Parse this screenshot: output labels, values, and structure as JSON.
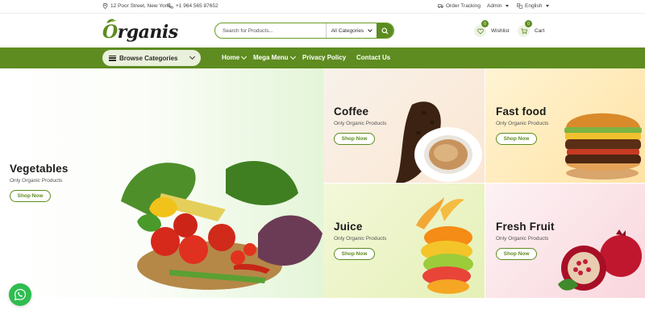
{
  "topbar": {
    "address": "12 Poor Street, New York.",
    "phone": "+1 964 565 87652",
    "order_tracking": "Order Tracking",
    "account": "Admin",
    "language": "English"
  },
  "header": {
    "logo": {
      "first": "O",
      "rest": "rganis"
    },
    "search": {
      "placeholder": "Search for Products...",
      "category": "All Categories"
    },
    "wishlist": {
      "label": "Wishlist",
      "count": "0"
    },
    "cart": {
      "label": "Cart",
      "count": "0"
    }
  },
  "nav": {
    "browse_label": "Browse Categories",
    "links": [
      {
        "label": "Home"
      },
      {
        "label": "Mega Menu"
      },
      {
        "label": "Privacy Policy"
      },
      {
        "label": "Contact Us"
      }
    ]
  },
  "banners": [
    {
      "title": "Vegetables",
      "subtitle": "Only Organic Products",
      "button": "Shop Now"
    },
    {
      "title": "Coffee",
      "subtitle": "Only Organic Products",
      "button": "Shop Now"
    },
    {
      "title": "Fast food",
      "subtitle": "Only Organic Products",
      "button": "Shop Now"
    },
    {
      "title": "Juice",
      "subtitle": "Only Organic Products",
      "button": "Shop Now"
    },
    {
      "title": "Fresh Fruit",
      "subtitle": "Only Organic Products",
      "button": "Shop Now"
    }
  ],
  "colors": {
    "brand_green": "#5e8c20",
    "whatsapp_green": "#2ebd4f"
  },
  "icons": [
    "location-icon",
    "phone-icon",
    "truck-icon",
    "user-icon",
    "language-icon",
    "search-icon",
    "heart-icon",
    "cart-icon",
    "menu-icon",
    "whatsapp-icon"
  ]
}
